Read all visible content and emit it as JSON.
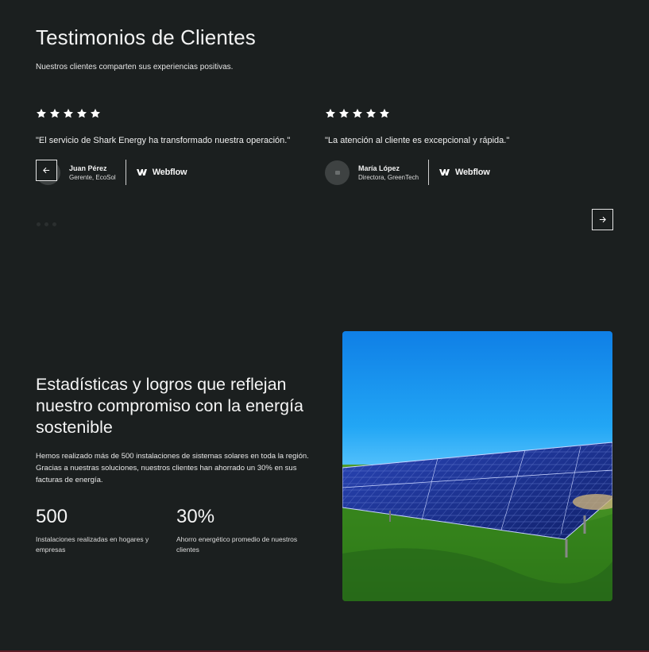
{
  "testimonials": {
    "title": "Testimonios de Clientes",
    "subtitle": "Nuestros clientes comparten sus experiencias positivas.",
    "rating": 5,
    "items": [
      {
        "quote": "\"El servicio de Shark Energy ha transformado nuestra operación.\"",
        "name": "Juan Pérez",
        "role": "Gerente, EcoSol",
        "brand": "Webflow"
      },
      {
        "quote": "\"La atención al cliente es excepcional y rápida.\"",
        "name": "María López",
        "role": "Directora, GreenTech",
        "brand": "Webflow"
      }
    ],
    "prev_icon": "arrow-left-icon",
    "next_icon": "arrow-right-icon",
    "dots": 3
  },
  "stats": {
    "title": "Estadísticas y logros que reflejan nuestro compromiso con la energía sostenible",
    "description": "Hemos realizado más de 500 instalaciones de sistemas solares en toda la región. Gracias a nuestras soluciones, nuestros clientes han ahorrado un 30% en sus facturas de energía.",
    "items": [
      {
        "value": "500",
        "label": "Instalaciones realizadas en hogares y empresas"
      },
      {
        "value": "30%",
        "label": "Ahorro energético promedio de nuestros clientes"
      }
    ]
  },
  "colors": {
    "background": "#1b1f1f",
    "text": "#ffffff",
    "sky": "#1e9bf0",
    "grass": "#3b8a22",
    "panel": "#1a2f8a"
  }
}
